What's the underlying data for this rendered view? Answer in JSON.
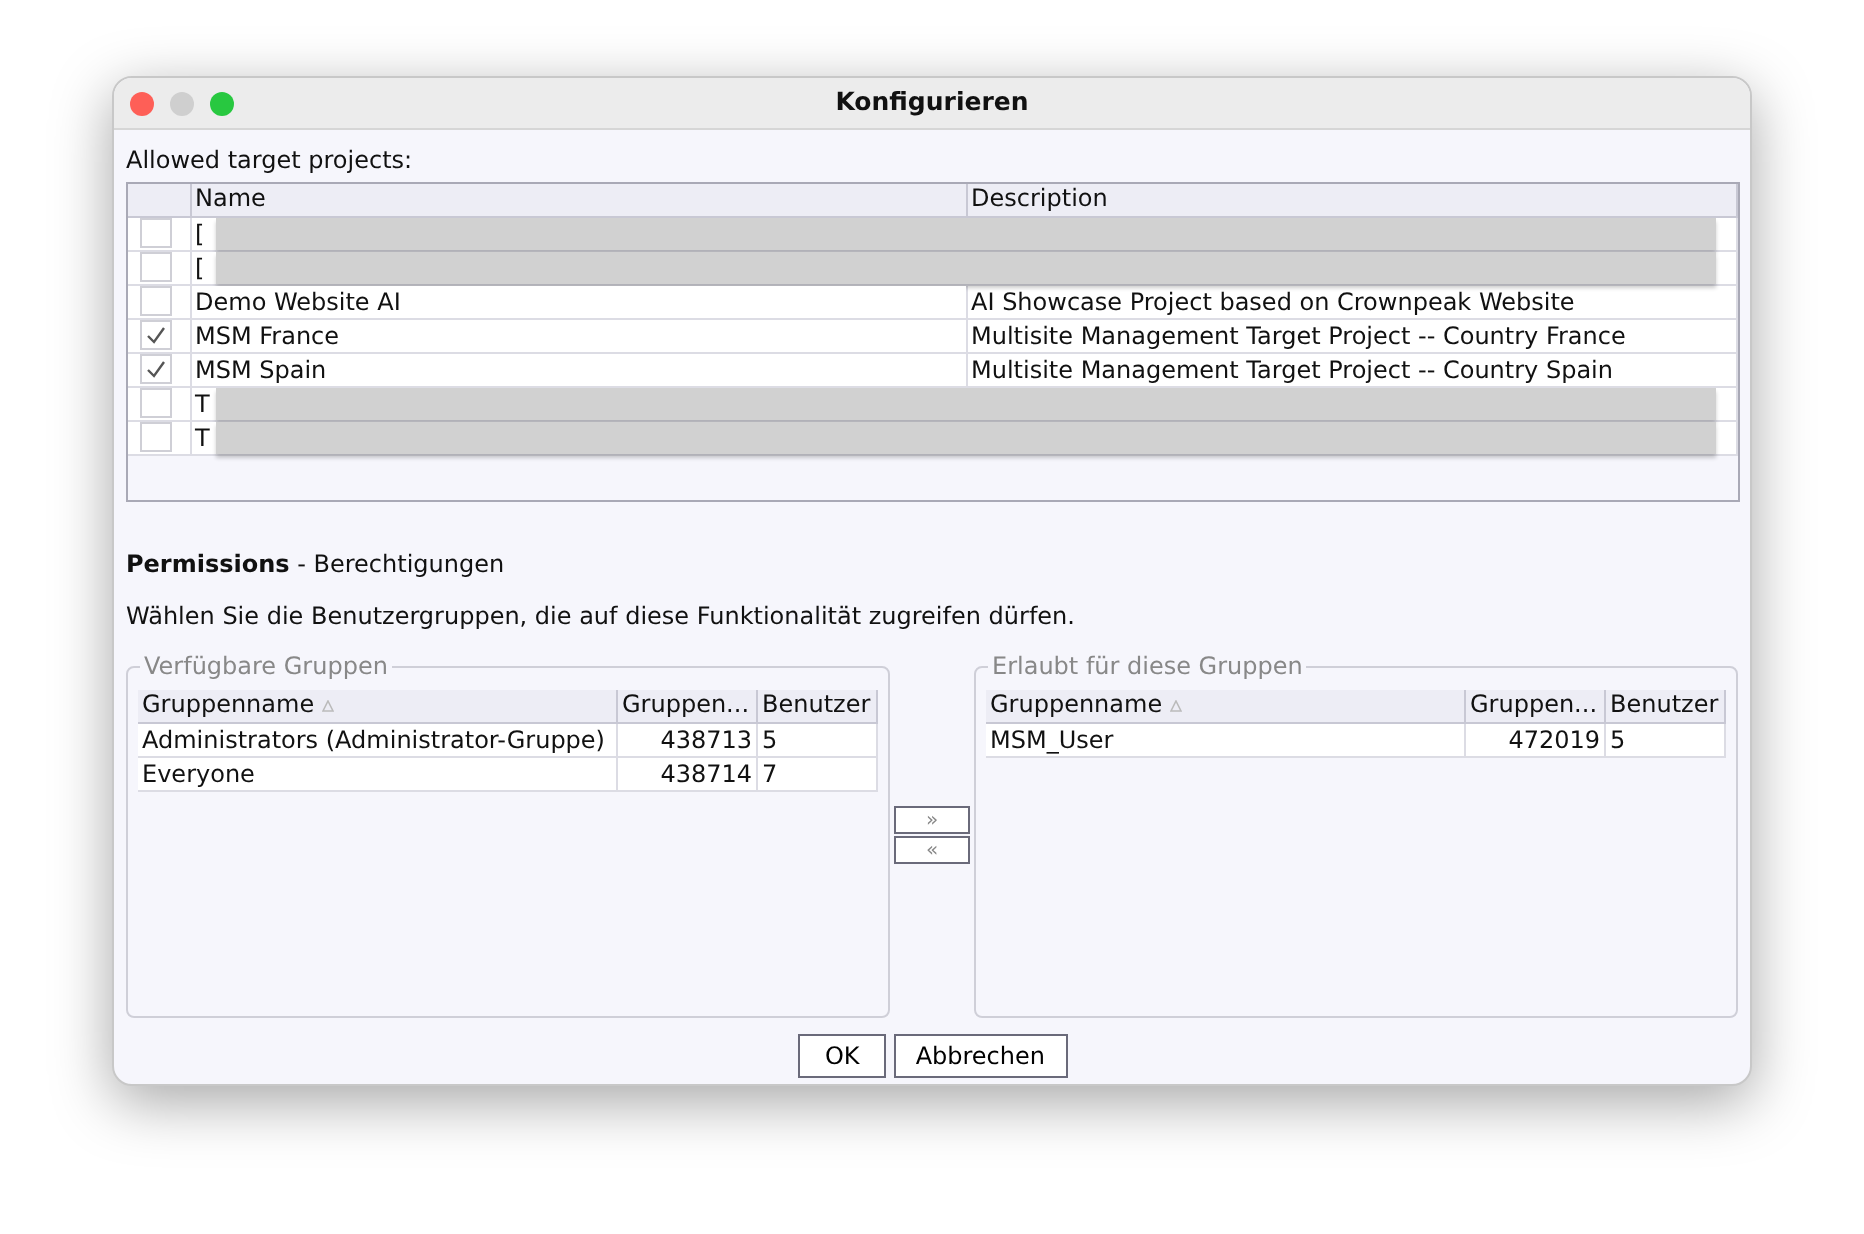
{
  "window": {
    "title": "Konfigurieren"
  },
  "projects": {
    "label": "Allowed target projects:",
    "columns": [
      "Name",
      "Description"
    ],
    "rows": [
      {
        "checked": false,
        "redacted": true,
        "name": "[",
        "description": ""
      },
      {
        "checked": false,
        "redacted": true,
        "name": "[",
        "description": ""
      },
      {
        "checked": false,
        "redacted": false,
        "name": "Demo Website AI",
        "description": "AI Showcase Project based on Crownpeak Website"
      },
      {
        "checked": true,
        "redacted": false,
        "name": "MSM France",
        "description": "Multisite Management Target Project -- Country France"
      },
      {
        "checked": true,
        "redacted": false,
        "name": "MSM Spain",
        "description": "Multisite Management Target Project -- Country Spain"
      },
      {
        "checked": false,
        "redacted": true,
        "name": "T",
        "description": ""
      },
      {
        "checked": false,
        "redacted": true,
        "name": "T",
        "description": ""
      }
    ]
  },
  "permissions": {
    "title": "Permissions",
    "subtitle": "- Berechtigungen",
    "hint": "Wählen Sie die Benutzergruppen, die auf diese Funktionalität zugreifen dürfen."
  },
  "available": {
    "title": "Verfügbare Gruppen",
    "columns": [
      "Gruppenname",
      "Gruppen...",
      "Benutzer"
    ],
    "rows": [
      [
        "Administrators (Administrator-Gruppe)",
        "438713",
        "5"
      ],
      [
        "Everyone",
        "438714",
        "7"
      ]
    ]
  },
  "transfer": {
    "add": "»",
    "remove": "«"
  },
  "allowed": {
    "title": "Erlaubt für diese Gruppen",
    "columns": [
      "Gruppenname",
      "Gruppen...",
      "Benutzer"
    ],
    "rows": [
      [
        "MSM_User",
        "472019",
        "5"
      ]
    ]
  },
  "buttons": [
    "OK",
    "Abbrechen"
  ]
}
